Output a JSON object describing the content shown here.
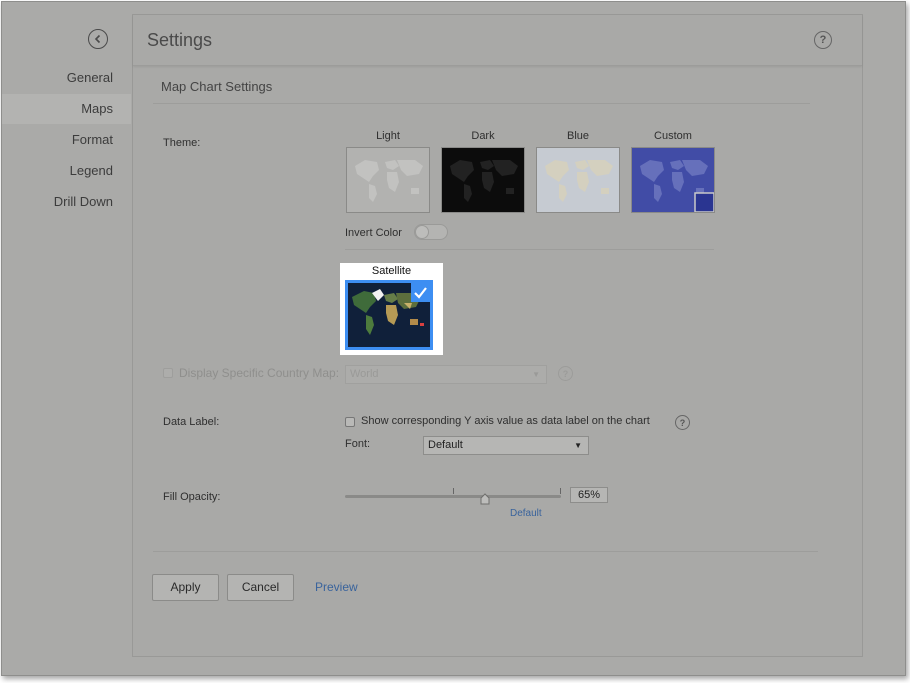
{
  "sidebar": {
    "items": [
      {
        "label": "General",
        "active": false
      },
      {
        "label": "Maps",
        "active": true
      },
      {
        "label": "Format",
        "active": false
      },
      {
        "label": "Legend",
        "active": false
      },
      {
        "label": "Drill Down",
        "active": false
      }
    ]
  },
  "header": {
    "title": "Settings"
  },
  "section": {
    "title": "Map Chart Settings"
  },
  "theme": {
    "label": "Theme:",
    "options": [
      {
        "name": "Light",
        "color": "#b2b2b0"
      },
      {
        "name": "Dark",
        "color": "#0c0c0c"
      },
      {
        "name": "Blue",
        "color": "#c6cbd2"
      },
      {
        "name": "Custom",
        "color": "#414ca6"
      }
    ],
    "invert_color_label": "Invert Color",
    "invert_color_on": false,
    "selected": {
      "name": "Satellite",
      "accent": "#3d8ef2"
    }
  },
  "country_map": {
    "label": "Display Specific Country Map:",
    "value": "World",
    "checked": false,
    "disabled": true
  },
  "data_label": {
    "label": "Data Label:",
    "checkbox_text": "Show corresponding Y axis value as data label on the chart",
    "checked": false,
    "font_label": "Font:",
    "font_value": "Default"
  },
  "fill_opacity": {
    "label": "Fill Opacity:",
    "value": "65%",
    "level": 0.65,
    "default_link": "Default"
  },
  "footer": {
    "apply_label": "Apply",
    "cancel_label": "Cancel",
    "preview_label": "Preview"
  }
}
